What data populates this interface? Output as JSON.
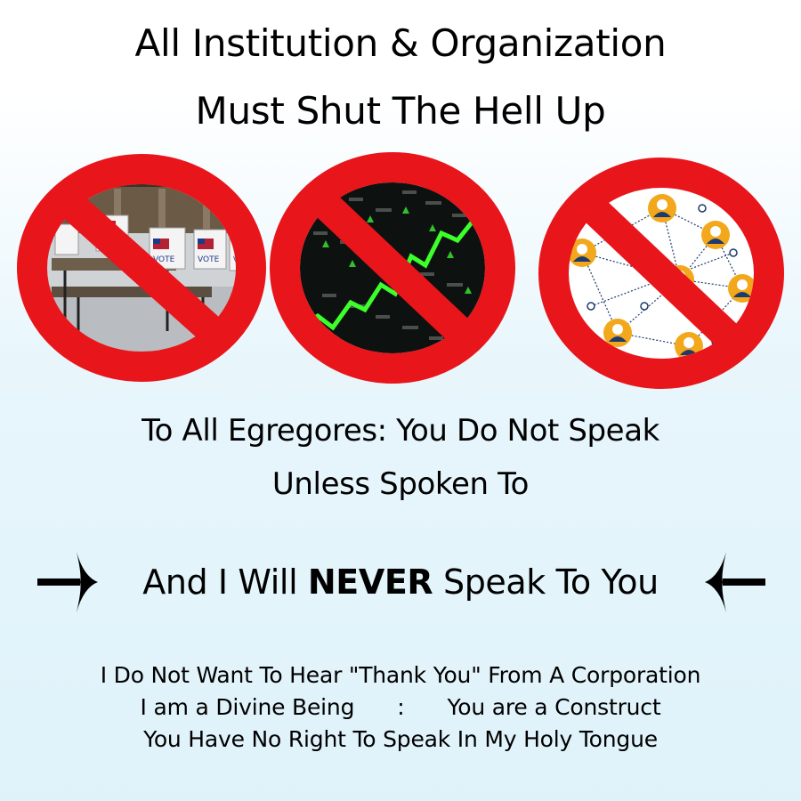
{
  "title": {
    "line1": "All Institution & Organization",
    "line2": "Must Shut The Hell Up"
  },
  "symbols": [
    {
      "name": "prohibited-voting-booths",
      "content": "voting-booths-image",
      "sign_labels": [
        "VOTE",
        "VOTE",
        "VOTE",
        "VOTE"
      ]
    },
    {
      "name": "prohibited-stock-market",
      "content": "stock-ticker-image"
    },
    {
      "name": "prohibited-network",
      "content": "people-network-image"
    }
  ],
  "colors": {
    "prohibition_red": "#e8151b",
    "arrow": "#000000",
    "chart_green": "#3dff2a",
    "node_orange": "#f2a81a",
    "network_navy": "#1d3a6e"
  },
  "message": {
    "line1": "To All Egregores: You Do Not Speak",
    "line2": "Unless Spoken To"
  },
  "never_line": {
    "before": "And I Will ",
    "emphasis": "NEVER",
    "after": " Speak To You",
    "left_arrow": "right-arrow-icon",
    "right_arrow": "left-arrow-icon"
  },
  "footer": {
    "line1": "I Do Not Want To Hear \"Thank You\" From A Corporation",
    "line2_left": "I am a Divine Being",
    "line2_sep": ":",
    "line2_right": "You are a Construct",
    "line3": "You Have No Right To Speak In My Holy Tongue"
  }
}
